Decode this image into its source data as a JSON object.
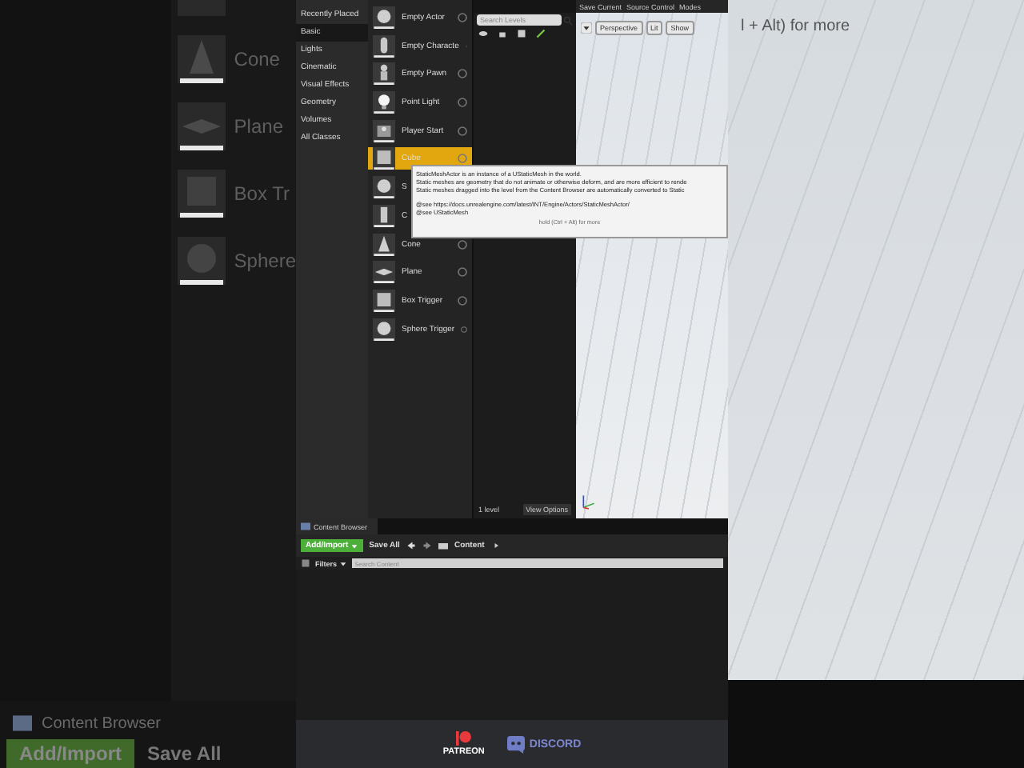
{
  "left_backdrop": {
    "items": [
      {
        "label": "Cone",
        "kind": "cone"
      },
      {
        "label": "Plane",
        "kind": "plane"
      },
      {
        "label": "Box Tr",
        "kind": "box-trigger"
      },
      {
        "label": "Sphere",
        "kind": "sphere-trigger"
      }
    ],
    "tab": "Content Browser",
    "add_button": "Add/Import",
    "save_button": "Save All"
  },
  "place_panel": {
    "categories": [
      {
        "label": "Recently Placed",
        "selected": false
      },
      {
        "label": "Basic",
        "selected": true
      },
      {
        "label": "Lights",
        "selected": false
      },
      {
        "label": "Cinematic",
        "selected": false
      },
      {
        "label": "Visual Effects",
        "selected": false
      },
      {
        "label": "Geometry",
        "selected": false
      },
      {
        "label": "Volumes",
        "selected": false
      },
      {
        "label": "All Classes",
        "selected": false
      }
    ],
    "items": [
      {
        "label": "Empty Actor",
        "kind": "sphere",
        "selected": false
      },
      {
        "label": "Empty Characte",
        "kind": "capsule",
        "selected": false
      },
      {
        "label": "Empty Pawn",
        "kind": "pawn",
        "selected": false
      },
      {
        "label": "Point Light",
        "kind": "light",
        "selected": false
      },
      {
        "label": "Player Start",
        "kind": "player",
        "selected": false
      },
      {
        "label": "Cube",
        "kind": "cube",
        "selected": true
      },
      {
        "label": "S",
        "kind": "sphere",
        "selected": false
      },
      {
        "label": "C",
        "kind": "cylinder",
        "selected": false
      },
      {
        "label": "Cone",
        "kind": "cone",
        "selected": false
      },
      {
        "label": "Plane",
        "kind": "plane",
        "selected": false
      },
      {
        "label": "Box Trigger",
        "kind": "box-trigger",
        "selected": false
      },
      {
        "label": "Sphere Trigger",
        "kind": "sphere-trigger",
        "selected": false
      }
    ]
  },
  "tooltip": {
    "lines": [
      "StaticMeshActor is an instance of a UStaticMesh in the world.",
      "Static meshes are geometry that do not animate or otherwise deform, and are more efficient to rende",
      "Static meshes dragged into the level from the Content Browser are automatically converted to Static"
    ],
    "see_also": [
      "@see https://docs.unrealengine.com/latest/INT/Engine/Actors/StaticMeshActor/",
      "@see UStaticMesh"
    ],
    "hint": "hold (Ctrl + Alt) for more"
  },
  "levels_panel": {
    "search": {
      "placeholder": "Search Levels"
    },
    "level_count": "1 level",
    "view_options": "View Options"
  },
  "toolbar": [
    "Save Current",
    "Source Control",
    "Modes"
  ],
  "viewport": {
    "buttons": [
      "Perspective",
      "Lit",
      "Show"
    ]
  },
  "content_browser": {
    "tab": "Content Browser",
    "add_button": "Add/Import",
    "save_button": "Save All",
    "path": "Content",
    "filters": "Filters",
    "search": {
      "placeholder": "Search Content"
    }
  },
  "right_backdrop": {
    "hint": "l + Alt) for more"
  },
  "footer": {
    "links": [
      {
        "label": "PATREON",
        "kind": "patreon"
      },
      {
        "label": "DISCORD",
        "kind": "discord"
      }
    ]
  }
}
